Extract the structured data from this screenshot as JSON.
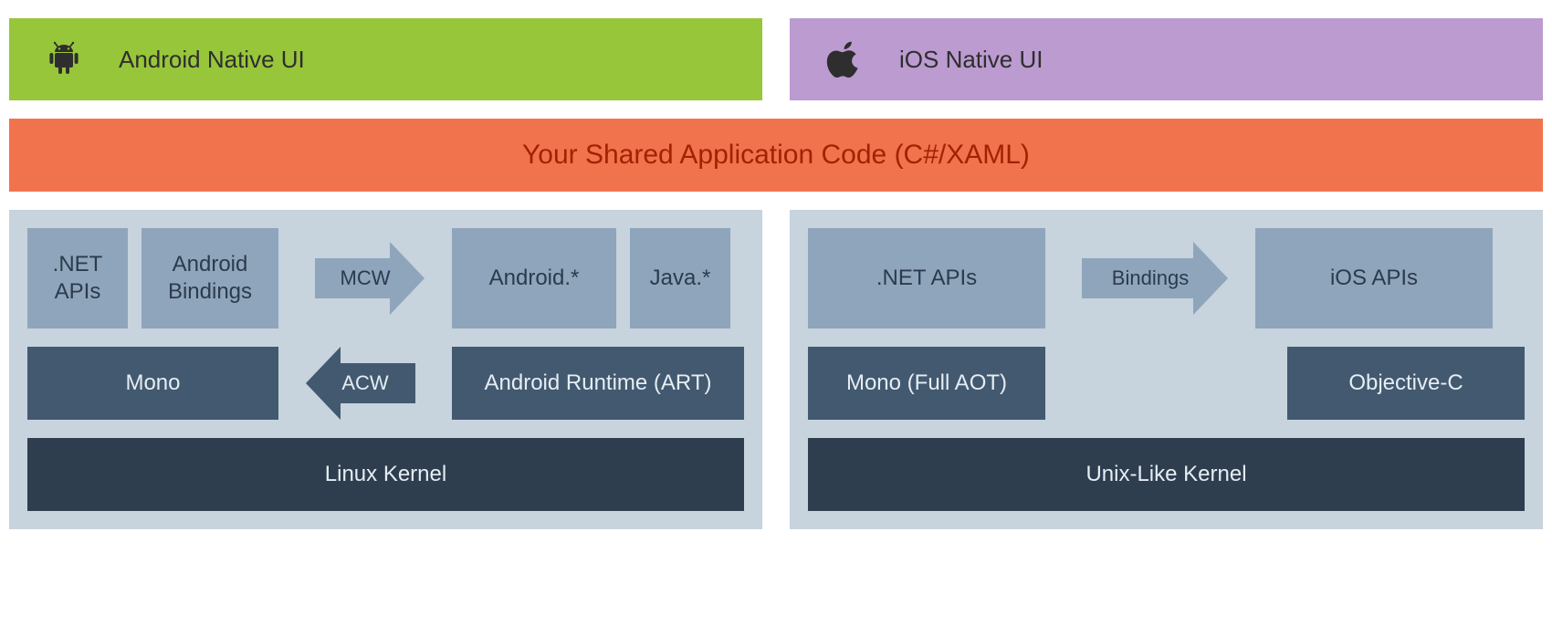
{
  "headers": {
    "android": "Android Native UI",
    "ios": "iOS Native UI"
  },
  "shared_banner": "Your Shared Application Code (C#/XAML)",
  "android_stack": {
    "row1": {
      "net_apis": ".NET APIs",
      "android_bindings": "Android Bindings",
      "mcw_arrow": "MCW",
      "android_star": "Android.*",
      "java_star": "Java.*"
    },
    "row2": {
      "mono": "Mono",
      "acw_arrow": "ACW",
      "art": "Android Runtime (ART)"
    },
    "kernel": "Linux Kernel"
  },
  "ios_stack": {
    "row1": {
      "net_apis": ".NET APIs",
      "bindings_arrow": "Bindings",
      "ios_apis": "iOS APIs"
    },
    "row2": {
      "mono_aot": "Mono (Full AOT)",
      "objc": "Objective-C"
    },
    "kernel": "Unix-Like Kernel"
  },
  "colors": {
    "android_green": "#98c63a",
    "ios_purple": "#bb9bd0",
    "orange": "#f1734e",
    "light_blue": "#8fa5bc",
    "mid_blue": "#425970",
    "dark_blue": "#2e3e4f",
    "container_bg": "#c7d3dd"
  }
}
